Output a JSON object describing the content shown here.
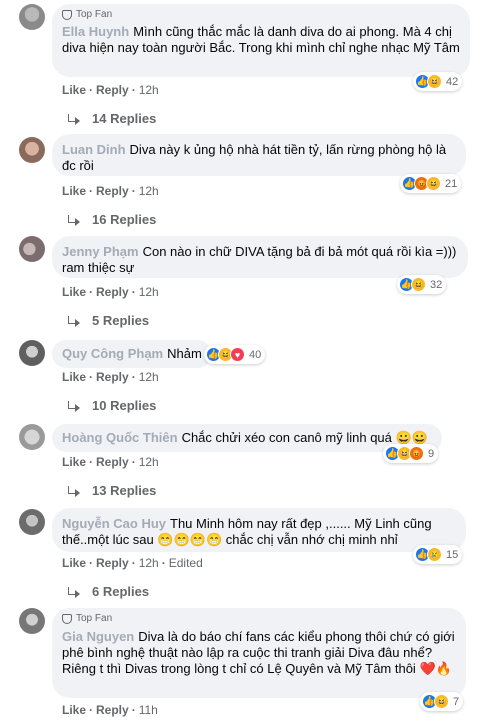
{
  "comments": [
    {
      "top_fan": "Top Fan",
      "name": "Ella Huynh",
      "text": "Mình cũng thắc mắc là danh diva do ai phong. Mà 4 chị diva hiện nay toàn người Bắc. Trong khi mình chỉ nghe nhạc Mỹ Tâm",
      "like": "Like",
      "reply": "Reply",
      "time": "12h",
      "reactions": [
        "like-icon",
        "haha-icon"
      ],
      "reaction_count": "42",
      "replies": "14 Replies"
    },
    {
      "name": "Luan Dinh",
      "text": "Diva này k ủng hộ nhà hát tiền tỷ, lấn rừng phòng hộ là đc rồi",
      "like": "Like",
      "reply": "Reply",
      "time": "12h",
      "reactions": [
        "like-icon",
        "angry-icon",
        "haha-icon"
      ],
      "reaction_count": "21",
      "replies": "16 Replies"
    },
    {
      "name": "Jenny Phạm",
      "text": "Con nào in chữ DIVA tặng bả đi bả mót quá rồi kìa =))) ram thiệc sự",
      "like": "Like",
      "reply": "Reply",
      "time": "12h",
      "reactions": [
        "like-icon",
        "haha-icon"
      ],
      "reaction_count": "32",
      "replies": "5 Replies"
    },
    {
      "name": "Quy Công Phạm",
      "text": "Nhảm",
      "like": "Like",
      "reply": "Reply",
      "time": "12h",
      "reactions": [
        "like-icon",
        "haha-icon",
        "love-icon"
      ],
      "reaction_count": "40",
      "replies": "10 Replies"
    },
    {
      "name": "Hoàng Quốc Thiên",
      "text": "Chắc chửi xéo con canô mỹ linh quá",
      "emoji": "😀😀",
      "like": "Like",
      "reply": "Reply",
      "time": "12h",
      "reactions": [
        "like-icon",
        "haha-icon",
        "angry-icon"
      ],
      "reaction_count": "9",
      "replies": "13 Replies"
    },
    {
      "name": "Nguyễn Cao Huy",
      "text_line1": "Thu Minh hôm nay rất đẹp ,...... Mỹ Linh cũng",
      "text_line2": "thế..một lúc sau",
      "emoji": "😁😁😁😁",
      "text_line2b": "chắc chị vẫn nhớ chị minh nhỉ",
      "like": "Like",
      "reply": "Reply",
      "time": "12h",
      "edited": "Edited",
      "reactions": [
        "like-icon",
        "sad-icon"
      ],
      "reaction_count": "15",
      "replies": "6 Replies"
    },
    {
      "top_fan": "Top Fan",
      "name": "Gia Nguyen",
      "text": "Diva là do báo chí fans các kiểu phong thôi chứ có giới phê bình nghệ thuật nào lập ra cuộc thi tranh giải Diva đâu nhể? Riêng t thì Divas trong lòng t chỉ có Lệ Quyên và Mỹ Tâm thôi",
      "emoji": "❤️🔥",
      "like": "Like",
      "reply": "Reply",
      "time": "11h",
      "reactions": [
        "like-icon",
        "haha-icon"
      ],
      "reaction_count": "7"
    }
  ]
}
